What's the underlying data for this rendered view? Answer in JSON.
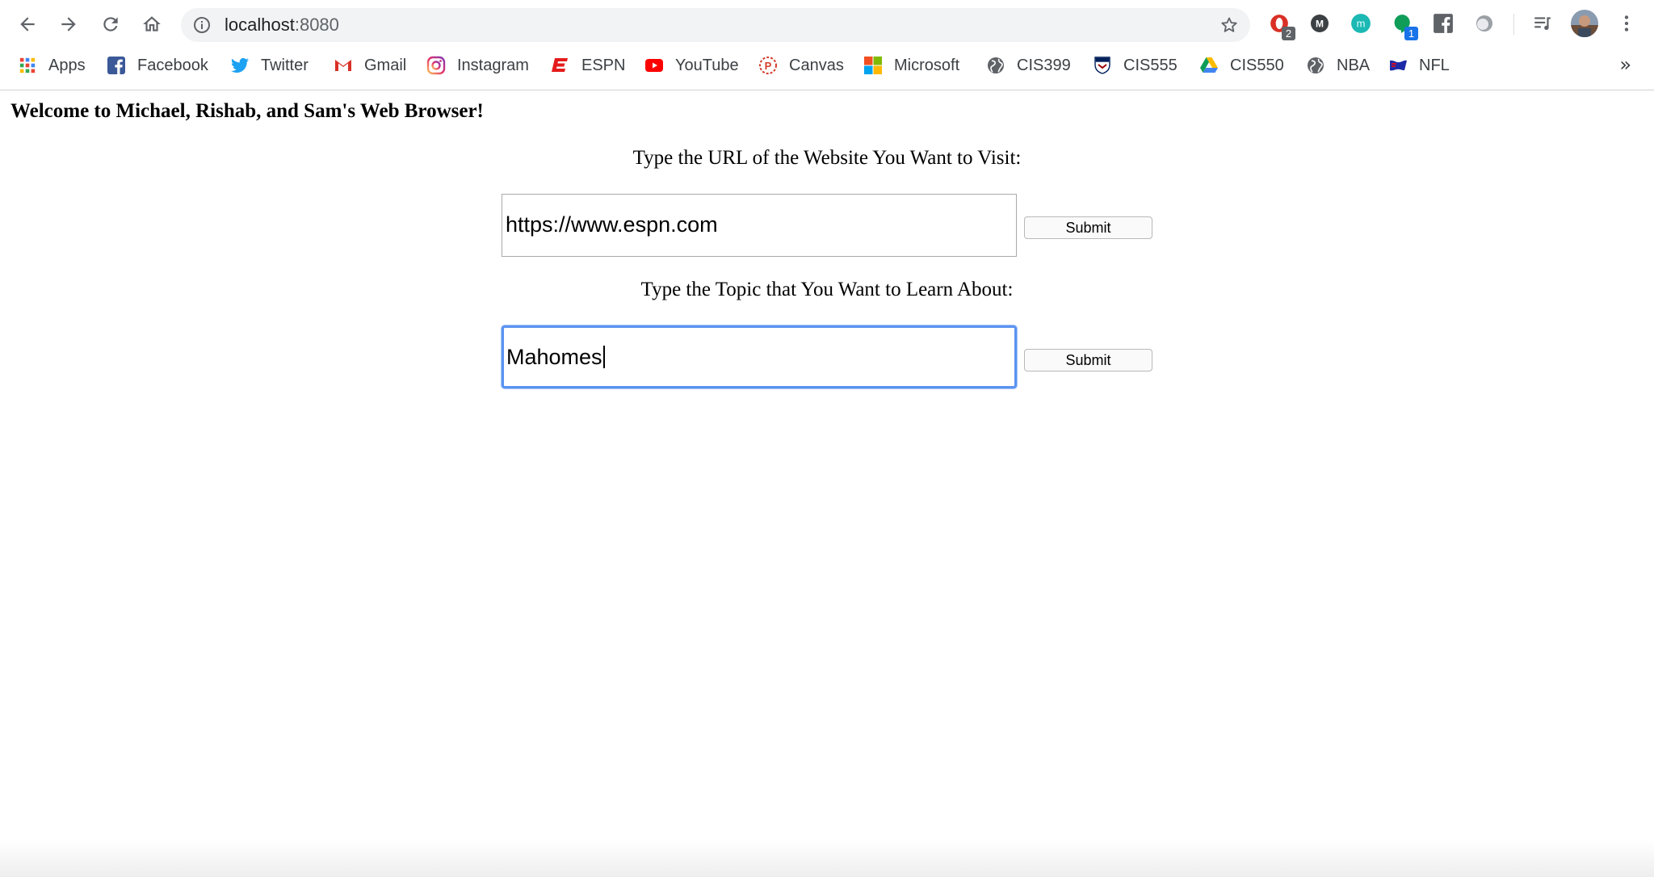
{
  "browser": {
    "url_host": "localhost",
    "url_port": ":8080",
    "extensions": [
      {
        "name": "opera-ext",
        "badge": "2",
        "color": "#d93025",
        "badge_color": "#5f6368"
      },
      {
        "name": "medium-ext",
        "label": "M",
        "color": "#3c4043"
      },
      {
        "name": "m-teal-ext",
        "label": "m",
        "color": "#1bb8b4"
      },
      {
        "name": "hangouts-ext",
        "badge": "1",
        "color": "#0f9d58",
        "badge_color": "#1a73e8"
      },
      {
        "name": "facebook-ext",
        "color": "#5f6368"
      },
      {
        "name": "circle-ext",
        "color": "#5f6368"
      }
    ]
  },
  "bookmarks": [
    {
      "label": "Apps",
      "icon": "apps-grid-icon"
    },
    {
      "label": "Facebook",
      "icon": "facebook-icon"
    },
    {
      "label": "Twitter",
      "icon": "twitter-icon"
    },
    {
      "label": "Gmail",
      "icon": "gmail-icon"
    },
    {
      "label": "Instagram",
      "icon": "instagram-icon"
    },
    {
      "label": "ESPN",
      "icon": "espn-icon"
    },
    {
      "label": "YouTube",
      "icon": "youtube-icon"
    },
    {
      "label": "Canvas",
      "icon": "canvas-icon"
    },
    {
      "label": "Microsoft",
      "icon": "microsoft-icon"
    },
    {
      "label": "CIS399",
      "icon": "globe-icon"
    },
    {
      "label": "CIS555",
      "icon": "penn-shield-icon"
    },
    {
      "label": "CIS550",
      "icon": "drive-icon"
    },
    {
      "label": "NBA",
      "icon": "globe-icon"
    },
    {
      "label": "NFL",
      "icon": "nfl-icon"
    }
  ],
  "bookmarks_overflow": "»",
  "page": {
    "title": "Welcome to Michael, Rishab, and Sam's Web Browser!",
    "url_prompt": "Type the URL of the Website You Want to Visit:",
    "url_value": "https://www.espn.com",
    "url_submit": "Submit",
    "topic_prompt": "Type the Topic that You Want to Learn About:",
    "topic_value": "Mahomes",
    "topic_submit": "Submit"
  },
  "colors": {
    "focus_ring": "#5b93f0",
    "chrome_bg": "#ffffff",
    "omnibox_bg": "#f1f3f4"
  }
}
